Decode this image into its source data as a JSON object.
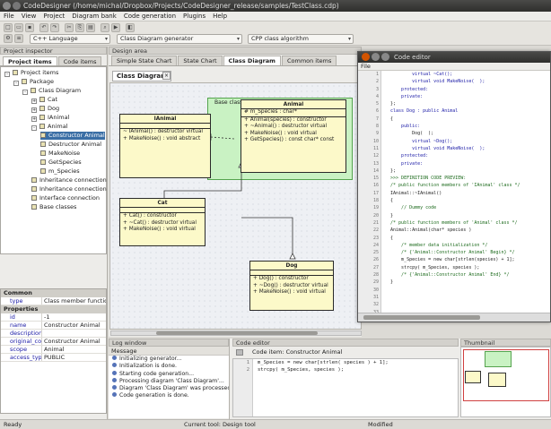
{
  "window": {
    "title": "CodeDesigner (/home/michal/Dropbox/Projects/CodeDesigner_release/samples/TestClass.cdp)"
  },
  "menu": [
    "File",
    "View",
    "Project",
    "Diagram bank",
    "Code generation",
    "Plugins",
    "Help"
  ],
  "toolbar": {
    "language": "C++ Language",
    "generator": "Class Diagram generator",
    "algorithm": "CPP class algorithm"
  },
  "project_inspector": {
    "header": "Project inspector",
    "tabs": [
      "Project items",
      "Code items"
    ],
    "tree": [
      {
        "label": "Project items",
        "level": 0,
        "exp": "-"
      },
      {
        "label": "Package",
        "level": 1,
        "exp": "-"
      },
      {
        "label": "Class Diagram",
        "level": 2,
        "exp": "-"
      },
      {
        "label": "Cat",
        "level": 3,
        "exp": "+"
      },
      {
        "label": "Dog",
        "level": 3,
        "exp": "+"
      },
      {
        "label": "IAnimal",
        "level": 3,
        "exp": "+"
      },
      {
        "label": "Animal",
        "level": 3,
        "exp": "-"
      },
      {
        "label": "Constructor Animal",
        "level": 4,
        "exp": "",
        "selected": true
      },
      {
        "label": "Destructor Animal",
        "level": 4,
        "exp": ""
      },
      {
        "label": "MakeNoise",
        "level": 4,
        "exp": ""
      },
      {
        "label": "GetSpecies",
        "level": 4,
        "exp": ""
      },
      {
        "label": "m_Species",
        "level": 4,
        "exp": ""
      },
      {
        "label": "Inheritance connection",
        "level": 3,
        "exp": ""
      },
      {
        "label": "Inheritance connection 2",
        "level": 3,
        "exp": ""
      },
      {
        "label": "Interface connection",
        "level": 3,
        "exp": ""
      },
      {
        "label": "Base classes",
        "level": 3,
        "exp": ""
      }
    ]
  },
  "properties": {
    "common_title": "Common",
    "common": [
      {
        "k": "type",
        "v": "Class member functio"
      }
    ],
    "props_title": "Properties",
    "props": [
      {
        "k": "id",
        "v": "-1"
      },
      {
        "k": "name",
        "v": "Constructor Animal"
      },
      {
        "k": "description",
        "v": ""
      },
      {
        "k": "original_code",
        "v": "Constructor Animal"
      },
      {
        "k": "scope",
        "v": "Animal"
      },
      {
        "k": "access_type",
        "v": "PUBLIC"
      }
    ]
  },
  "design_area": {
    "header": "Design area",
    "tabs": [
      "Simple State Chart",
      "State Chart",
      "Class Diagram",
      "Common items"
    ],
    "active_tab": "Class Diagram",
    "diagram_title": "Class Diagram",
    "package_label": "Base classes",
    "classes": {
      "ianimal": {
        "name": "IAnimal",
        "attrs": [],
        "ops": [
          "~ IAnimal() : destructor virtual",
          "+ MakeNoise() : void abstract"
        ]
      },
      "animal": {
        "name": "Animal",
        "attrs": [
          "# m_Species : char*"
        ],
        "ops": [
          "+ Animal(species) : constructor",
          "+ ~Animal() : destructor virtual",
          "+ MakeNoise() : void virtual",
          "+ GetSpecies() : const char* const"
        ]
      },
      "cat": {
        "name": "Cat",
        "attrs": [],
        "ops": [
          "+ Cat() : constructor",
          "+ ~Cat() : destructor virtual",
          "+ MakeNoise() : void virtual"
        ]
      },
      "dog": {
        "name": "Dog",
        "attrs": [],
        "ops": [
          "+ Dog() : constructor",
          "+ ~Dog() : destructor virtual",
          "+ MakeNoise() : void virtual"
        ]
      }
    }
  },
  "code_editor_window": {
    "title": "Code editor",
    "menu": "File",
    "lines": [
      "          virtual ~Cat();",
      "          virtual void MakeNoise(  );",
      "",
      "      protected:",
      "",
      "      private:",
      "",
      "  };",
      "",
      "  class Dog : public Animal",
      "  {",
      "      public:",
      "          Dog(  );",
      "          virtual ~Dog();",
      "          virtual void MakeNoise(  );",
      "",
      "      protected:",
      "",
      "      private:",
      "",
      "  };",
      "",
      "  >>> DEFINITION CODE PREVIEW:",
      "",
      "  /* public function members of 'IAnimal' class */",
      "  IAnimal::~IAnimal()",
      "  {",
      "      // Dummy code",
      "  }",
      "",
      "  /* public function members of 'Animal' class */",
      "  Animal::Animal(char* species )",
      "  {",
      "      /* member data initialization */",
      "",
      "      /* {'Animal::Constructor Animal' Begin} */",
      "      m_Species = new char[strlen(species) + 1];",
      "      strcpy( m_Species, species );",
      "      /* {'Animal::Constructor Animal' End} */",
      "  }"
    ]
  },
  "log": {
    "header": "Log window",
    "col": "Message",
    "rows": [
      "Initializing generator...",
      "Initialization is done.",
      "Starting code generation...",
      "Processing diagram 'Class Diagram'...",
      "Diagram 'Class Diagram' was processed",
      "Code generation is done."
    ]
  },
  "code_panel": {
    "header": "Code editor",
    "item": "Code item: Constructor Animal",
    "lines": [
      "m_Species = new char[strlen( species ) + 1];",
      "strcpy( m_Species, species );"
    ],
    "line_numbers": [
      "1",
      "2"
    ]
  },
  "thumbnail": {
    "header": "Thumbnail"
  },
  "status": {
    "left": "Ready",
    "tool": "Current tool: Design tool",
    "state": "Modified"
  }
}
